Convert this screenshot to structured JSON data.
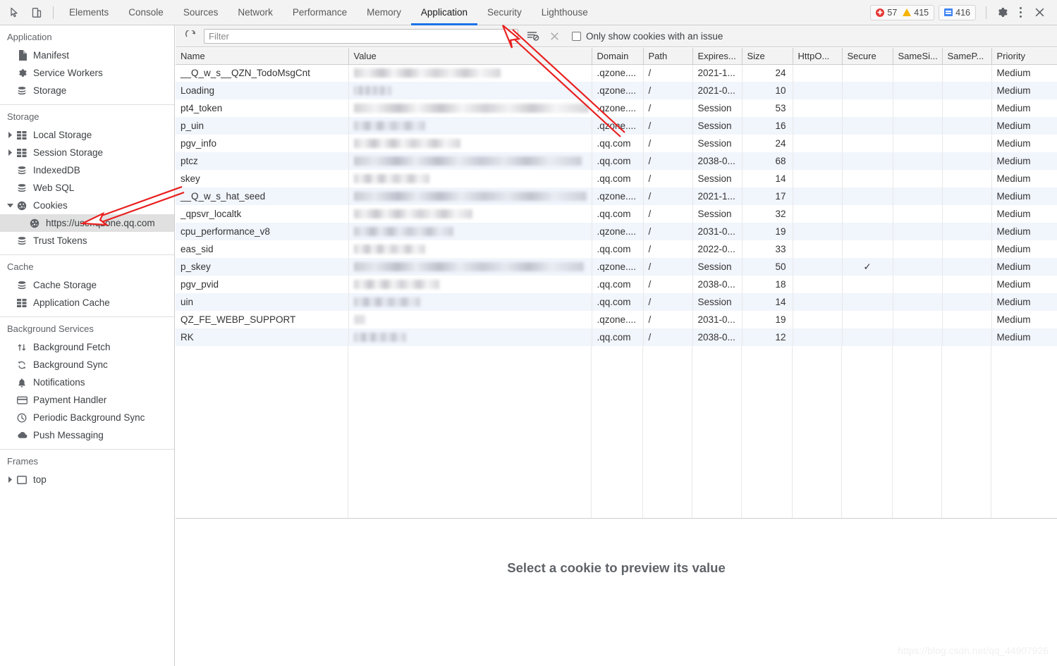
{
  "toolbar": {
    "inspect_icon": "inspect-cursor-icon",
    "device_icon": "device-toolbar-icon",
    "tabs": [
      {
        "label": "Elements",
        "active": false
      },
      {
        "label": "Console",
        "active": false
      },
      {
        "label": "Sources",
        "active": false
      },
      {
        "label": "Network",
        "active": false
      },
      {
        "label": "Performance",
        "active": false
      },
      {
        "label": "Memory",
        "active": false
      },
      {
        "label": "Application",
        "active": true
      },
      {
        "label": "Security",
        "active": false
      },
      {
        "label": "Lighthouse",
        "active": false
      }
    ],
    "errors_count": "57",
    "warnings_count": "415",
    "messages_count": "416",
    "settings_icon": "gear-icon",
    "more_icon": "kebab-menu-icon",
    "close_icon": "close-icon"
  },
  "sidebar": {
    "sections": [
      {
        "title": "Application",
        "items": [
          {
            "label": "Manifest",
            "icon": "manifest-file-icon",
            "indent": 0,
            "arrow": "none",
            "selected": false
          },
          {
            "label": "Service Workers",
            "icon": "gear-icon",
            "indent": 0,
            "arrow": "none",
            "selected": false
          },
          {
            "label": "Storage",
            "icon": "database-icon",
            "indent": 0,
            "arrow": "none",
            "selected": false
          }
        ]
      },
      {
        "title": "Storage",
        "items": [
          {
            "label": "Local Storage",
            "icon": "table-grid-icon",
            "indent": 0,
            "arrow": "collapsed",
            "selected": false
          },
          {
            "label": "Session Storage",
            "icon": "table-grid-icon",
            "indent": 0,
            "arrow": "collapsed",
            "selected": false
          },
          {
            "label": "IndexedDB",
            "icon": "database-icon",
            "indent": 0,
            "arrow": "none",
            "selected": false
          },
          {
            "label": "Web SQL",
            "icon": "database-icon",
            "indent": 0,
            "arrow": "none",
            "selected": false
          },
          {
            "label": "Cookies",
            "icon": "cookie-icon",
            "indent": 0,
            "arrow": "expanded",
            "selected": false
          },
          {
            "label": "https://user.qzone.qq.com",
            "icon": "cookie-icon",
            "indent": 1,
            "arrow": "none",
            "selected": true
          },
          {
            "label": "Trust Tokens",
            "icon": "database-icon",
            "indent": 0,
            "arrow": "none",
            "selected": false
          }
        ]
      },
      {
        "title": "Cache",
        "items": [
          {
            "label": "Cache Storage",
            "icon": "database-icon",
            "indent": 0,
            "arrow": "none",
            "selected": false
          },
          {
            "label": "Application Cache",
            "icon": "table-grid-icon",
            "indent": 0,
            "arrow": "none",
            "selected": false
          }
        ]
      },
      {
        "title": "Background Services",
        "items": [
          {
            "label": "Background Fetch",
            "icon": "arrows-up-down-icon",
            "indent": 0,
            "arrow": "none",
            "selected": false
          },
          {
            "label": "Background Sync",
            "icon": "sync-icon",
            "indent": 0,
            "arrow": "none",
            "selected": false
          },
          {
            "label": "Notifications",
            "icon": "bell-icon",
            "indent": 0,
            "arrow": "none",
            "selected": false
          },
          {
            "label": "Payment Handler",
            "icon": "credit-card-icon",
            "indent": 0,
            "arrow": "none",
            "selected": false
          },
          {
            "label": "Periodic Background Sync",
            "icon": "clock-icon",
            "indent": 0,
            "arrow": "none",
            "selected": false
          },
          {
            "label": "Push Messaging",
            "icon": "cloud-icon",
            "indent": 0,
            "arrow": "none",
            "selected": false
          }
        ]
      },
      {
        "title": "Frames",
        "items": [
          {
            "label": "top",
            "icon": "frame-icon",
            "indent": 0,
            "arrow": "collapsed",
            "selected": false
          }
        ]
      }
    ]
  },
  "filter_bar": {
    "refresh_icon": "refresh-icon",
    "placeholder": "Filter",
    "value": "",
    "clear_all_icon": "clear-all-cookies-icon",
    "delete_icon": "delete-selected-icon",
    "only_issues_label": "Only show cookies with an issue",
    "only_issues_checked": false
  },
  "table": {
    "columns": [
      "Name",
      "Value",
      "Domain",
      "Path",
      "Expires...",
      "Size",
      "HttpO...",
      "Secure",
      "SameSi...",
      "SameP...",
      "Priority"
    ],
    "rows": [
      {
        "name": "__Q_w_s__QZN_TodoMsgCnt",
        "value": "",
        "domain": ".qzone....",
        "path": "/",
        "expires": "2021-1...",
        "size": "24",
        "httponly": "",
        "secure": "",
        "samesite": "",
        "sameparty": "",
        "priority": "Medium"
      },
      {
        "name": "Loading",
        "value": "",
        "domain": ".qzone....",
        "path": "/",
        "expires": "2021-0...",
        "size": "10",
        "httponly": "",
        "secure": "",
        "samesite": "",
        "sameparty": "",
        "priority": "Medium"
      },
      {
        "name": "pt4_token",
        "value": "",
        "domain": ".qzone....",
        "path": "/",
        "expires": "Session",
        "size": "53",
        "httponly": "",
        "secure": "",
        "samesite": "",
        "sameparty": "",
        "priority": "Medium"
      },
      {
        "name": "p_uin",
        "value": "",
        "domain": ".qzone....",
        "path": "/",
        "expires": "Session",
        "size": "16",
        "httponly": "",
        "secure": "",
        "samesite": "",
        "sameparty": "",
        "priority": "Medium"
      },
      {
        "name": "pgv_info",
        "value": "",
        "domain": ".qq.com",
        "path": "/",
        "expires": "Session",
        "size": "24",
        "httponly": "",
        "secure": "",
        "samesite": "",
        "sameparty": "",
        "priority": "Medium"
      },
      {
        "name": "ptcz",
        "value": "",
        "domain": ".qq.com",
        "path": "/",
        "expires": "2038-0...",
        "size": "68",
        "httponly": "",
        "secure": "",
        "samesite": "",
        "sameparty": "",
        "priority": "Medium"
      },
      {
        "name": "skey",
        "value": "",
        "domain": ".qq.com",
        "path": "/",
        "expires": "Session",
        "size": "14",
        "httponly": "",
        "secure": "",
        "samesite": "",
        "sameparty": "",
        "priority": "Medium"
      },
      {
        "name": "__Q_w_s_hat_seed",
        "value": "",
        "domain": ".qzone....",
        "path": "/",
        "expires": "2021-1...",
        "size": "17",
        "httponly": "",
        "secure": "",
        "samesite": "",
        "sameparty": "",
        "priority": "Medium"
      },
      {
        "name": "_qpsvr_localtk",
        "value": "",
        "domain": ".qq.com",
        "path": "/",
        "expires": "Session",
        "size": "32",
        "httponly": "",
        "secure": "",
        "samesite": "",
        "sameparty": "",
        "priority": "Medium"
      },
      {
        "name": "cpu_performance_v8",
        "value": "",
        "domain": ".qzone....",
        "path": "/",
        "expires": "2031-0...",
        "size": "19",
        "httponly": "",
        "secure": "",
        "samesite": "",
        "sameparty": "",
        "priority": "Medium"
      },
      {
        "name": "eas_sid",
        "value": "",
        "domain": ".qq.com",
        "path": "/",
        "expires": "2022-0...",
        "size": "33",
        "httponly": "",
        "secure": "",
        "samesite": "",
        "sameparty": "",
        "priority": "Medium"
      },
      {
        "name": "p_skey",
        "value": "",
        "domain": ".qzone....",
        "path": "/",
        "expires": "Session",
        "size": "50",
        "httponly": "",
        "secure": "✓",
        "samesite": "",
        "sameparty": "",
        "priority": "Medium"
      },
      {
        "name": "pgv_pvid",
        "value": "",
        "domain": ".qq.com",
        "path": "/",
        "expires": "2038-0...",
        "size": "18",
        "httponly": "",
        "secure": "",
        "samesite": "",
        "sameparty": "",
        "priority": "Medium"
      },
      {
        "name": "uin",
        "value": "",
        "domain": ".qq.com",
        "path": "/",
        "expires": "Session",
        "size": "14",
        "httponly": "",
        "secure": "",
        "samesite": "",
        "sameparty": "",
        "priority": "Medium"
      },
      {
        "name": "QZ_FE_WEBP_SUPPORT",
        "value": "",
        "domain": ".qzone....",
        "path": "/",
        "expires": "2031-0...",
        "size": "19",
        "httponly": "",
        "secure": "",
        "samesite": "",
        "sameparty": "",
        "priority": "Medium"
      },
      {
        "name": "RK",
        "value": "",
        "domain": ".qq.com",
        "path": "/",
        "expires": "2038-0...",
        "size": "12",
        "httponly": "",
        "secure": "",
        "samesite": "",
        "sameparty": "",
        "priority": "Medium"
      }
    ],
    "value_column_redacted": true
  },
  "preview": {
    "message": "Select a cookie to preview its value"
  },
  "watermark": {
    "text": "https://blog.csdn.net/qq_44907926"
  },
  "annotations": {
    "arrow_color": "#e8201f",
    "arrow_1_target": "filter-input-right-edge",
    "arrow_2_target": "sidebar-item-cookies"
  }
}
